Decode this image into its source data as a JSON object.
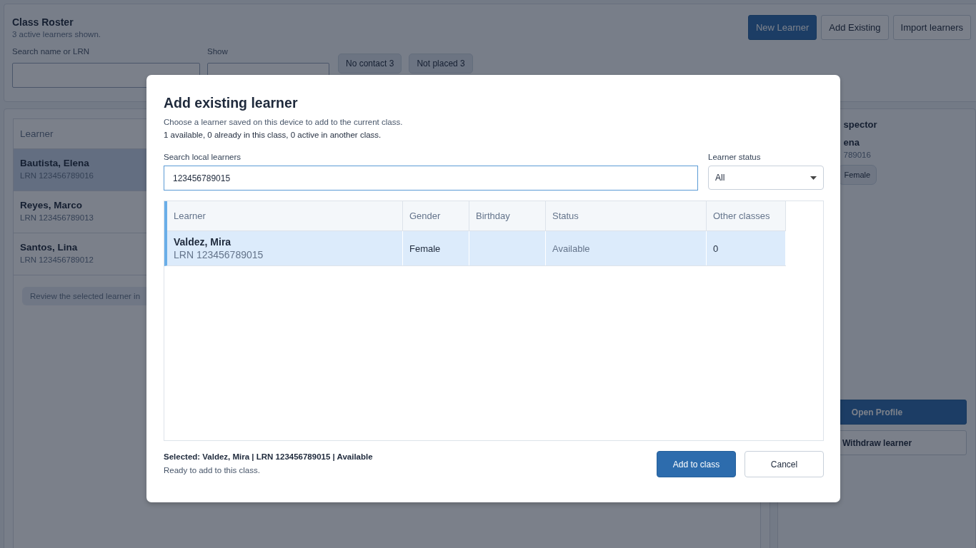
{
  "roster": {
    "title": "Class Roster",
    "subtitle": "3 active learners shown.",
    "search": {
      "label": "Search name or LRN"
    },
    "show": {
      "label": "Show"
    },
    "chips": [
      "No contact 3",
      "Not placed 3"
    ],
    "buttons": [
      {
        "label": "New Learner",
        "kind": "primary"
      },
      {
        "label": "Add Existing",
        "kind": "secondary"
      },
      {
        "label": "Import learners",
        "kind": "secondary"
      }
    ]
  },
  "learner_list": {
    "column": "Learner",
    "rows": [
      {
        "name": "Bautista, Elena",
        "lrn": "LRN 123456789016",
        "selected": true
      },
      {
        "name": "Reyes, Marco",
        "lrn": "LRN 123456789013",
        "selected": false
      },
      {
        "name": "Santos, Lina",
        "lrn": "LRN 123456789012",
        "selected": false
      }
    ],
    "hint": "Review the selected learner in"
  },
  "inspector": {
    "title": "spector",
    "name": "ena",
    "lrn": "789016",
    "tag": "Female",
    "buttons": [
      {
        "label": "Open Profile",
        "kind": "primary"
      },
      {
        "label": "Withdraw learner",
        "kind": "secondary"
      }
    ]
  },
  "dialog": {
    "title": "Add existing learner",
    "description": "Choose a learner saved on this device to add to the current class.",
    "counts": "1 available, 0 already in this class, 0 active in another class.",
    "search": {
      "label": "Search local learners",
      "value": "123456789015"
    },
    "status_filter": {
      "label": "Learner status",
      "value": "All"
    },
    "table": {
      "columns": [
        "Learner",
        "Gender",
        "Birthday",
        "Status",
        "Other classes"
      ],
      "rows": [
        {
          "name": "Valdez, Mira",
          "lrn": "LRN 123456789015",
          "gender": "Female",
          "status": "Available",
          "other_classes": "0",
          "selected": true
        }
      ]
    },
    "selection": "Selected: Valdez, Mira | LRN 123456789015 | Available",
    "selection_note": "Ready to add to this class.",
    "buttons": [
      {
        "label": "Add to class",
        "kind": "primary"
      },
      {
        "label": "Cancel",
        "kind": "secondary"
      }
    ]
  }
}
